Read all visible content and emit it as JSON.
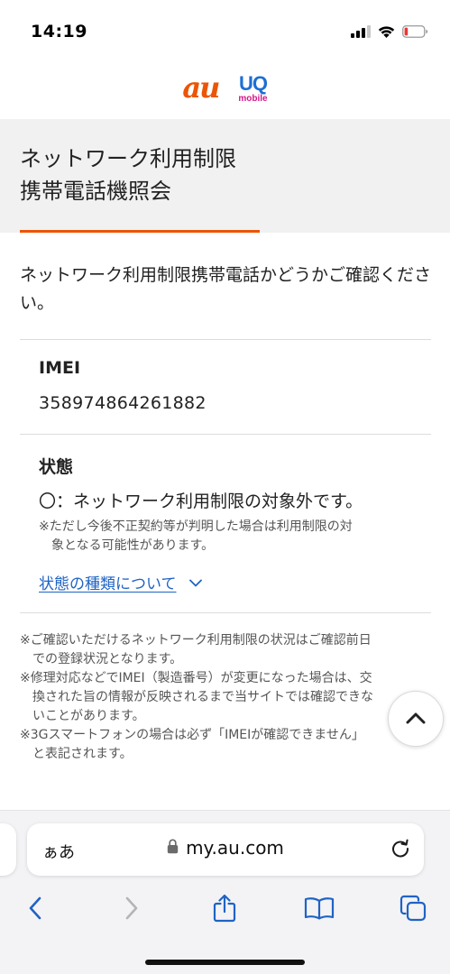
{
  "status_bar": {
    "time": "14:19",
    "icons": [
      "cellular-signal-icon",
      "wifi-icon",
      "battery-low-icon"
    ],
    "battery_color": "#e53935"
  },
  "logos": {
    "au": "au",
    "uq": "UQ",
    "uq_sub": "mobile",
    "colors": {
      "au": "#eb5505",
      "uq": "#1c6fd4",
      "mobile": "#d4178a"
    }
  },
  "page": {
    "title_line1": "ネットワーク利用制限",
    "title_line2": "携帯電話機照会",
    "accent_color": "#eb5505",
    "intro": "ネットワーク利用制限携帯電話かどうかご確認ください。"
  },
  "result": {
    "imei_label": "IMEI",
    "imei_value": "358974864261882",
    "status_label": "状態",
    "status_value": "〇：ネットワーク利用制限の対象外です。",
    "status_note_line1": "※ただし今後不正契約等が判明した場合は利用制限の対",
    "status_note_line2": "象となる可能性があります。",
    "status_types_link": "状態の種類について"
  },
  "notes": [
    "※ご確認いただけるネットワーク利用制限の状況はご確認前日",
    "　での登録状況となります。",
    "※修理対応などでIMEI（製造番号）が変更になった場合は、交",
    "　換された旨の情報が反映されるまで当サイトでは確認できな",
    "　いことがあります。",
    "※3Gスマートフォンの場合は必ず「IMEIが確認できません」",
    "　と表記されます。"
  ],
  "browser": {
    "aa_label": "ぁあ",
    "url": "my.au.com",
    "link_color": "#1f63c4",
    "toolbar_icons": [
      "back-icon",
      "forward-icon",
      "share-icon",
      "bookmarks-icon",
      "tabs-icon"
    ]
  }
}
